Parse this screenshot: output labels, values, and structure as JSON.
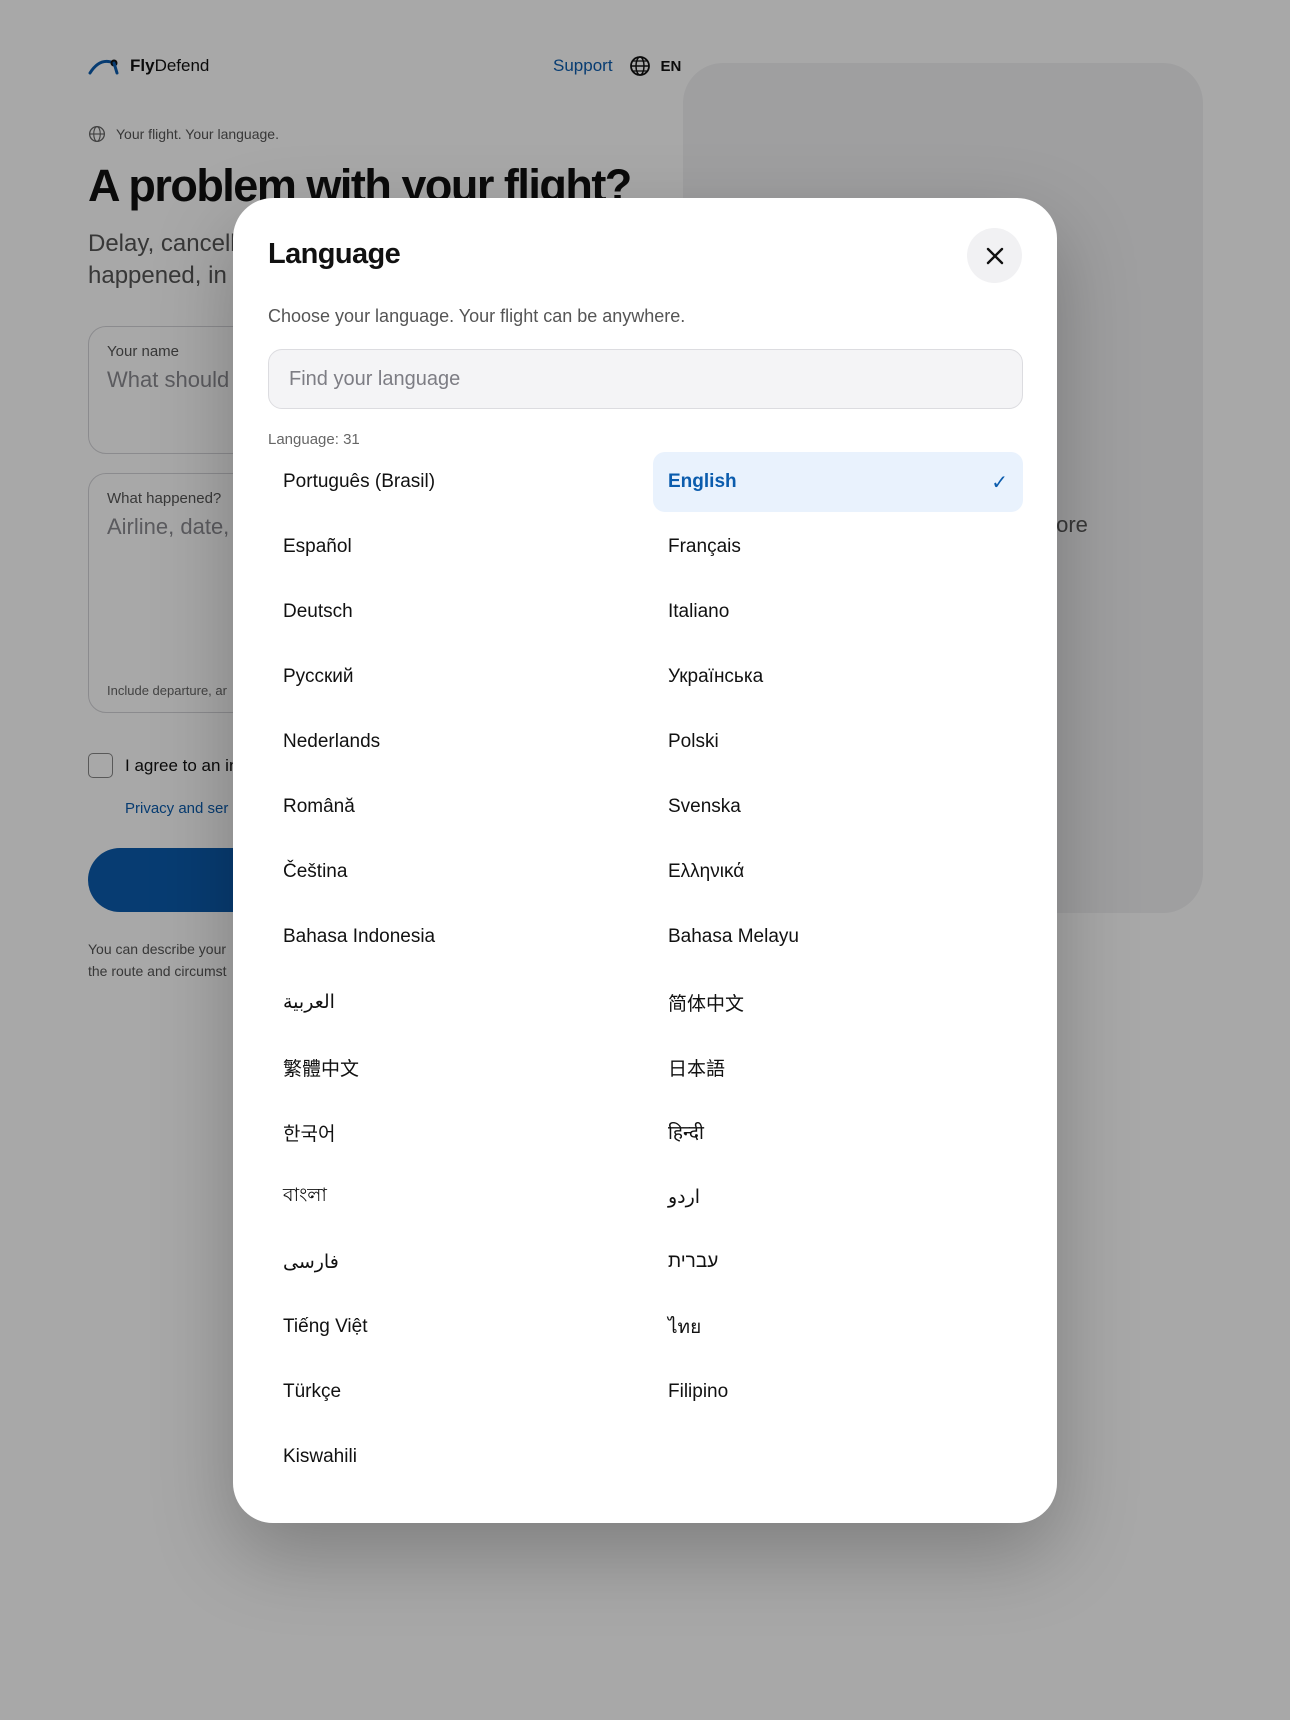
{
  "brand": {
    "bold": "Fly",
    "rest": "Defend"
  },
  "nav": {
    "support": "Support",
    "language_code": "EN"
  },
  "hero": {
    "tagline": "Your flight. Your language.",
    "headline": "A problem with your flight?",
    "subline_1": "Delay, cancella",
    "subline_2": "happened, in y",
    "side_text": "fore"
  },
  "form": {
    "name_label": "Your name",
    "name_placeholder": "What should",
    "what_label": "What happened?",
    "what_placeholder": "Airline, date,",
    "what_hint": "Include departure, ar",
    "agree_text": "I agree to an in",
    "privacy_link": "Privacy and ser",
    "footnote_1": "You can describe your",
    "footnote_2": "the route and circumst"
  },
  "modal": {
    "title": "Language",
    "description": "Choose your language. Your flight can be anywhere.",
    "search_placeholder": "Find your language",
    "count_label": "Language: 31",
    "selected_check": "✓"
  },
  "languages": [
    {
      "label": "Português (Brasil)",
      "selected": false
    },
    {
      "label": "English",
      "selected": true
    },
    {
      "label": "Español",
      "selected": false
    },
    {
      "label": "Français",
      "selected": false
    },
    {
      "label": "Deutsch",
      "selected": false
    },
    {
      "label": "Italiano",
      "selected": false
    },
    {
      "label": "Русский",
      "selected": false
    },
    {
      "label": "Українська",
      "selected": false
    },
    {
      "label": "Nederlands",
      "selected": false
    },
    {
      "label": "Polski",
      "selected": false
    },
    {
      "label": "Română",
      "selected": false
    },
    {
      "label": "Svenska",
      "selected": false
    },
    {
      "label": "Čeština",
      "selected": false
    },
    {
      "label": "Ελληνικά",
      "selected": false
    },
    {
      "label": "Bahasa Indonesia",
      "selected": false
    },
    {
      "label": "Bahasa Melayu",
      "selected": false
    },
    {
      "label": "العربية",
      "selected": false
    },
    {
      "label": "简体中文",
      "selected": false
    },
    {
      "label": "繁體中文",
      "selected": false
    },
    {
      "label": "日本語",
      "selected": false
    },
    {
      "label": "한국어",
      "selected": false
    },
    {
      "label": "हिन्दी",
      "selected": false
    },
    {
      "label": "বাংলা",
      "selected": false
    },
    {
      "label": "اردو",
      "selected": false
    },
    {
      "label": "فارسی",
      "selected": false
    },
    {
      "label": "עברית",
      "selected": false
    },
    {
      "label": "Tiếng Việt",
      "selected": false
    },
    {
      "label": "ไทย",
      "selected": false
    },
    {
      "label": "Türkçe",
      "selected": false
    },
    {
      "label": "Filipino",
      "selected": false
    },
    {
      "label": "Kiswahili",
      "selected": false
    }
  ],
  "colors": {
    "accent": "#0b5cad",
    "selected_bg": "#e9f2fd",
    "scrim": "rgba(0,0,0,0.34)"
  },
  "icons": {
    "brand": "plane-arc-icon",
    "globe": "globe-icon",
    "close": "close-icon",
    "check": "checkmark-icon"
  }
}
